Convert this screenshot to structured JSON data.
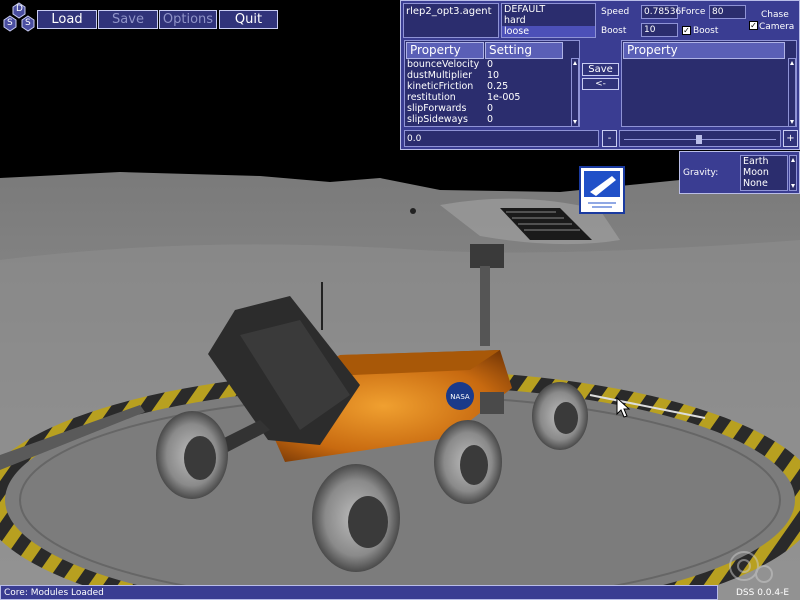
{
  "toolbar": {
    "logo_letters": [
      "D",
      "S",
      "S"
    ],
    "load_label": "Load",
    "save_label": "Save",
    "options_label": "Options",
    "quit_label": "Quit"
  },
  "agent_panel": {
    "agent_file": "rlep2_opt3.agent",
    "presets": [
      "DEFAULT",
      "hard",
      "loose"
    ],
    "selected_preset": "loose",
    "speed_label": "Speed",
    "speed_value": "0.78536",
    "force_label": "Force",
    "force_value": "80",
    "boost_label": "Boost",
    "boost_value": "10",
    "boost_check_label": "Boost",
    "chase_camera_line1": "Chase",
    "chase_camera_line2": "Camera",
    "property_header": "Property",
    "setting_header": "Setting",
    "properties": [
      {
        "name": "bounceVelocity",
        "value": "0"
      },
      {
        "name": "dustMultiplier",
        "value": "10"
      },
      {
        "name": "kineticFriction",
        "value": "0.25"
      },
      {
        "name": "restitution",
        "value": "1e-005"
      },
      {
        "name": "slipForwards",
        "value": "0"
      },
      {
        "name": "slipSideways",
        "value": "0"
      }
    ],
    "save_button": "Save",
    "arrow_button": "<-",
    "right_property_header": "Property",
    "value_field": "0.0",
    "minus_button": "-",
    "plus_button": "+"
  },
  "gravity_panel": {
    "label": "Gravity:",
    "options": [
      "Earth",
      "Moon",
      "None"
    ]
  },
  "status_bar": {
    "message": "Core: Modules Loaded",
    "version": "DSS 0.0.4-E"
  },
  "colors": {
    "panel": "#3a3d92",
    "panel_border": "#b9bde8",
    "sky": "#000000",
    "lunar_surface": "#8a8a8a",
    "rover_body": "#c86a10"
  }
}
